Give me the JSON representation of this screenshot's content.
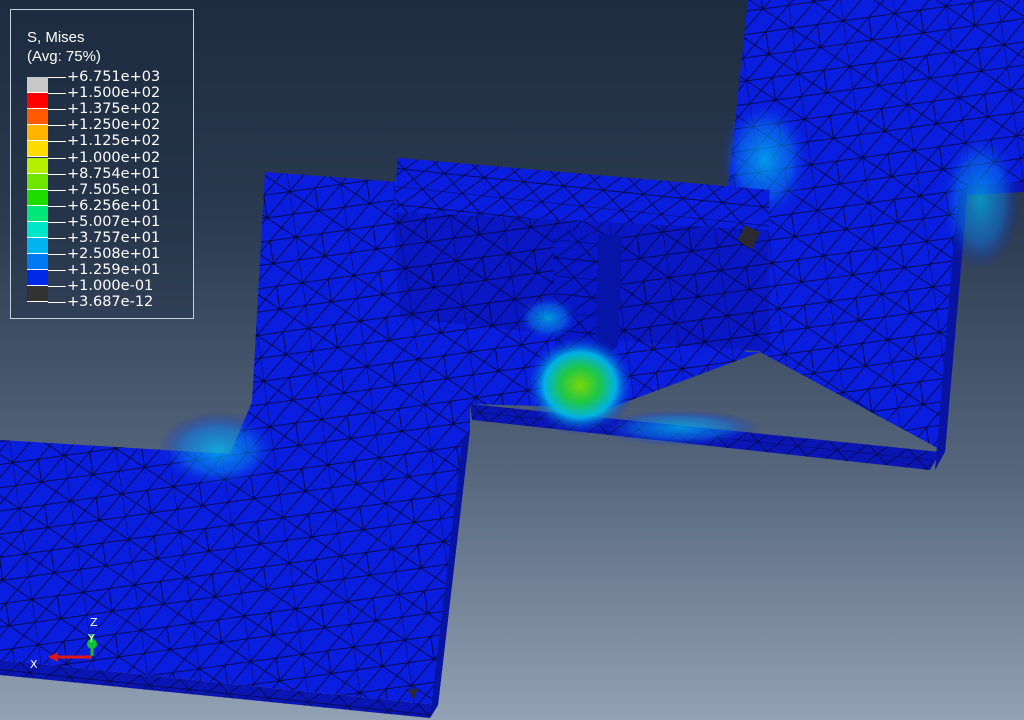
{
  "legend": {
    "title": "S, Mises",
    "subtitle": "(Avg: 75%)",
    "values": [
      "+6.751e+03",
      "+1.500e+02",
      "+1.375e+02",
      "+1.250e+02",
      "+1.125e+02",
      "+1.000e+02",
      "+8.754e+01",
      "+7.505e+01",
      "+6.256e+01",
      "+5.007e+01",
      "+3.757e+01",
      "+2.508e+01",
      "+1.259e+01",
      "+1.000e-01",
      "+3.687e-12"
    ],
    "colors": [
      "#c8c8c8",
      "#ff0000",
      "#ff5a00",
      "#ffb400",
      "#ffdc00",
      "#b4f000",
      "#6ee600",
      "#1edc00",
      "#00e678",
      "#00e6c8",
      "#00b4f0",
      "#0078f0",
      "#0028e6",
      "#323232"
    ]
  },
  "triad": {
    "x": "X",
    "y": "Y",
    "z": "Z"
  },
  "colors": {
    "mesh_blue": "#0a1ee0",
    "side_blue": "#0a18b8",
    "mesh_line": "#00000a",
    "hot_green": "#50d200",
    "cyan": "#00a8f0"
  }
}
